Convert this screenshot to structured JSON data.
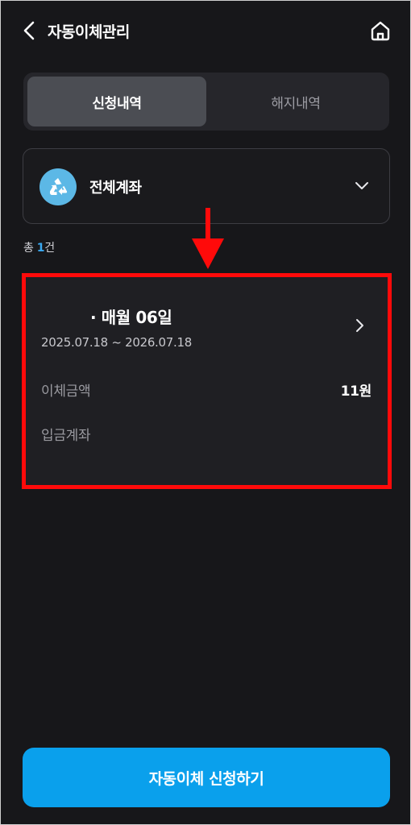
{
  "header": {
    "title": "자동이체관리",
    "back_icon": "chevron-left-icon",
    "home_icon": "home-icon"
  },
  "tabs": [
    {
      "label": "신청내역",
      "active": true
    },
    {
      "label": "해지내역",
      "active": false
    }
  ],
  "account_selector": {
    "label": "전체계좌",
    "icon": "recycle-icon",
    "icon_color": "#5cb8e6",
    "dropdown_icon": "chevron-down-icon"
  },
  "summary": {
    "prefix": "총 ",
    "count": "1",
    "suffix": "건"
  },
  "transfers": [
    {
      "title": "· 매월 06일",
      "period": "2025.07.18 ~ 2026.07.18",
      "amount_label": "이체금액",
      "amount_value": "11원",
      "account_label": "입금계좌",
      "account_value": ""
    }
  ],
  "cta": {
    "label": "자동이체 신청하기",
    "color": "#0aa0ec"
  },
  "colors": {
    "background": "#17171a",
    "accent": "#3aa8f0",
    "highlight": "#ff0a0a"
  }
}
